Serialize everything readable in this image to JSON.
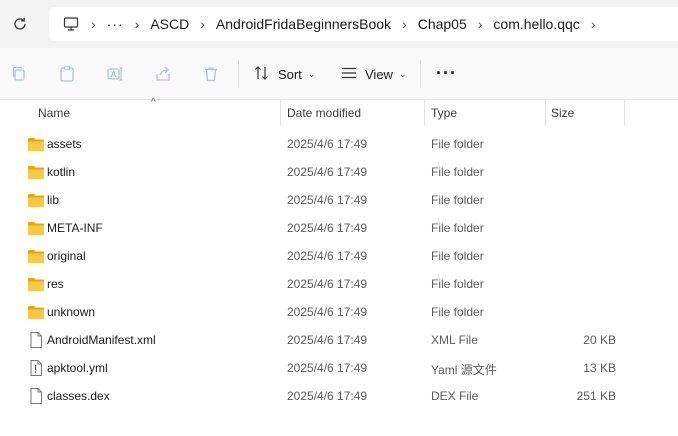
{
  "breadcrumb": {
    "items": [
      "ASCD",
      "AndroidFridaBeginnersBook",
      "Chap05",
      "com.hello.qqc"
    ],
    "overflow": "···",
    "separator": "›"
  },
  "toolbar": {
    "sort_label": "Sort",
    "view_label": "View",
    "more_label": "···"
  },
  "columns": {
    "name": "Name",
    "date": "Date modified",
    "type": "Type",
    "size": "Size"
  },
  "files": [
    {
      "name": "assets",
      "date": "2025/4/6 17:49",
      "type": "File folder",
      "size": "",
      "icon": "folder-icon"
    },
    {
      "name": "kotlin",
      "date": "2025/4/6 17:49",
      "type": "File folder",
      "size": "",
      "icon": "folder-icon"
    },
    {
      "name": "lib",
      "date": "2025/4/6 17:49",
      "type": "File folder",
      "size": "",
      "icon": "folder-icon"
    },
    {
      "name": "META-INF",
      "date": "2025/4/6 17:49",
      "type": "File folder",
      "size": "",
      "icon": "folder-icon"
    },
    {
      "name": "original",
      "date": "2025/4/6 17:49",
      "type": "File folder",
      "size": "",
      "icon": "folder-icon"
    },
    {
      "name": "res",
      "date": "2025/4/6 17:49",
      "type": "File folder",
      "size": "",
      "icon": "folder-icon"
    },
    {
      "name": "unknown",
      "date": "2025/4/6 17:49",
      "type": "File folder",
      "size": "",
      "icon": "folder-icon"
    },
    {
      "name": "AndroidManifest.xml",
      "date": "2025/4/6 17:49",
      "type": "XML File",
      "size": "20 KB",
      "icon": "file-icon"
    },
    {
      "name": "apktool.yml",
      "date": "2025/4/6 17:49",
      "type": "Yaml 源文件",
      "size": "13 KB",
      "icon": "yaml-file-icon"
    },
    {
      "name": "classes.dex",
      "date": "2025/4/6 17:49",
      "type": "DEX File",
      "size": "251 KB",
      "icon": "file-icon"
    }
  ],
  "colors": {
    "folder": "#f7c948",
    "folder_dark": "#e8a800",
    "toolbar_bg": "#f9f9f9",
    "address_bg": "#f3f3f3"
  }
}
